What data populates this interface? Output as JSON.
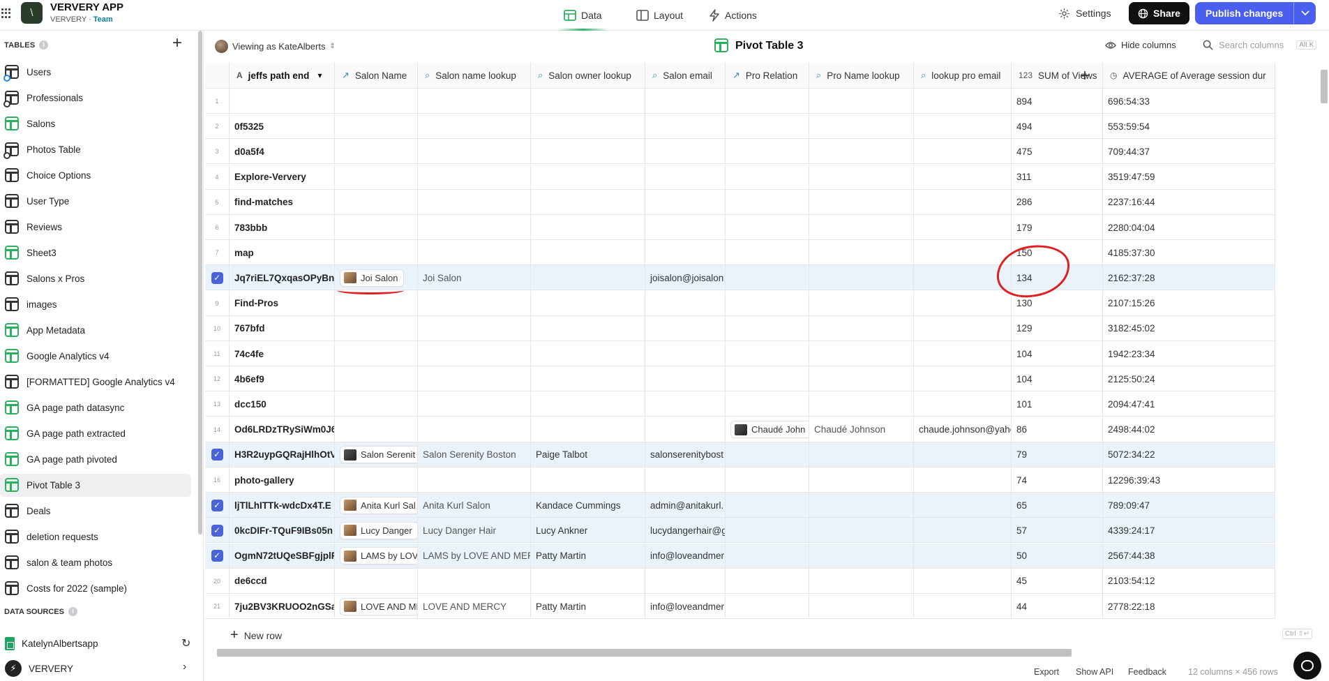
{
  "app": {
    "name": "VERVERY APP",
    "org": "VERVERY",
    "plan": "Team",
    "logo_char": "\\"
  },
  "topnav": {
    "data": "Data",
    "layout": "Layout",
    "actions": "Actions",
    "settings": "Settings",
    "share": "Share",
    "publish": "Publish changes"
  },
  "sidebar": {
    "tables_heading": "TABLES",
    "items": [
      {
        "label": "Users",
        "icon": "table-icon-users",
        "green": false
      },
      {
        "label": "Professionals",
        "icon": "table-icon",
        "green": false
      },
      {
        "label": "Salons",
        "icon": "table-icon",
        "green": true
      },
      {
        "label": "Photos Table",
        "icon": "table-icon",
        "green": false
      },
      {
        "label": "Choice Options",
        "icon": "table-icon",
        "green": false
      },
      {
        "label": "User Type",
        "icon": "table-icon",
        "green": false
      },
      {
        "label": "Reviews",
        "icon": "table-icon",
        "green": false
      },
      {
        "label": "Sheet3",
        "icon": "table-icon",
        "green": true
      },
      {
        "label": "Salons x Pros",
        "icon": "table-icon",
        "green": false
      },
      {
        "label": "images",
        "icon": "table-icon",
        "green": false
      },
      {
        "label": "App Metadata",
        "icon": "table-icon",
        "green": true
      },
      {
        "label": "Google Analytics v4",
        "icon": "table-icon",
        "green": true
      },
      {
        "label": "[FORMATTED] Google Analytics v4",
        "icon": "table-icon",
        "green": false
      },
      {
        "label": "GA page path datasync",
        "icon": "table-icon",
        "green": true
      },
      {
        "label": "GA page path extracted",
        "icon": "table-icon",
        "green": true
      },
      {
        "label": "GA page path pivoted",
        "icon": "table-icon",
        "green": true
      },
      {
        "label": "Pivot Table 3",
        "icon": "table-icon",
        "green": true
      },
      {
        "label": "Deals",
        "icon": "table-icon",
        "green": false
      },
      {
        "label": "deletion requests",
        "icon": "table-icon",
        "green": false
      },
      {
        "label": "salon & team photos",
        "icon": "table-icon",
        "green": false
      },
      {
        "label": "Costs for 2022 (sample)",
        "icon": "table-icon",
        "green": false
      }
    ],
    "data_sources_heading": "DATA SOURCES",
    "data_sources": [
      {
        "label": "KatelynAlbertsapp"
      },
      {
        "label": "VERVERY"
      }
    ]
  },
  "toolbar": {
    "viewing_as": "Viewing as KateAlberts",
    "title": "Pivot Table 3",
    "hide_columns": "Hide columns",
    "search_placeholder": "Search columns",
    "search_shortcut": "Alt K"
  },
  "grid": {
    "columns": [
      {
        "label": "jeffs path end",
        "icon": "A"
      },
      {
        "label": "Salon Name",
        "icon": "relation"
      },
      {
        "label": "Salon name lookup",
        "icon": "lookup"
      },
      {
        "label": "Salon owner lookup",
        "icon": "lookup"
      },
      {
        "label": "Salon email",
        "icon": "lookup"
      },
      {
        "label": "Pro Relation",
        "icon": "relation"
      },
      {
        "label": "Pro Name lookup",
        "icon": "lookup"
      },
      {
        "label": "lookup pro email",
        "icon": "lookup"
      },
      {
        "label": "SUM of Views",
        "icon": "123"
      },
      {
        "label": "AVERAGE of Average session dur",
        "icon": "clock"
      }
    ],
    "rows": [
      {
        "n": "1",
        "sel": false,
        "path": "",
        "salon": "",
        "salon_lookup": "",
        "owner": "",
        "email": "",
        "pro": "",
        "pro_name": "",
        "pro_email": "",
        "views": "894",
        "avg": "696:54:33"
      },
      {
        "n": "2",
        "sel": false,
        "path": "0f5325",
        "salon": "",
        "salon_lookup": "",
        "owner": "",
        "email": "",
        "pro": "",
        "pro_name": "",
        "pro_email": "",
        "views": "494",
        "avg": "553:59:54"
      },
      {
        "n": "3",
        "sel": false,
        "path": "d0a5f4",
        "salon": "",
        "salon_lookup": "",
        "owner": "",
        "email": "",
        "pro": "",
        "pro_name": "",
        "pro_email": "",
        "views": "475",
        "avg": "709:44:37"
      },
      {
        "n": "4",
        "sel": false,
        "path": "Explore-Ververy",
        "salon": "",
        "salon_lookup": "",
        "owner": "",
        "email": "",
        "pro": "",
        "pro_name": "",
        "pro_email": "",
        "views": "311",
        "avg": "3519:47:59"
      },
      {
        "n": "5",
        "sel": false,
        "path": "find-matches",
        "salon": "",
        "salon_lookup": "",
        "owner": "",
        "email": "",
        "pro": "",
        "pro_name": "",
        "pro_email": "",
        "views": "286",
        "avg": "2237:16:44"
      },
      {
        "n": "6",
        "sel": false,
        "path": "783bbb",
        "salon": "",
        "salon_lookup": "",
        "owner": "",
        "email": "",
        "pro": "",
        "pro_name": "",
        "pro_email": "",
        "views": "179",
        "avg": "2280:04:04"
      },
      {
        "n": "7",
        "sel": false,
        "path": "map",
        "salon": "",
        "salon_lookup": "",
        "owner": "",
        "email": "",
        "pro": "",
        "pro_name": "",
        "pro_email": "",
        "views": "150",
        "avg": "4185:37:30"
      },
      {
        "n": "8",
        "sel": true,
        "path": "Jq7riEL7QxqasOPyBnF",
        "salon": "Joi Salon",
        "salon_lookup": "Joi Salon",
        "owner": "",
        "email": "joisalon@joisalon",
        "pro": "",
        "pro_name": "",
        "pro_email": "",
        "views": "134",
        "avg": "2162:37:28"
      },
      {
        "n": "9",
        "sel": false,
        "path": "Find-Pros",
        "salon": "",
        "salon_lookup": "",
        "owner": "",
        "email": "",
        "pro": "",
        "pro_name": "",
        "pro_email": "",
        "views": "130",
        "avg": "2107:15:26"
      },
      {
        "n": "10",
        "sel": false,
        "path": "767bfd",
        "salon": "",
        "salon_lookup": "",
        "owner": "",
        "email": "",
        "pro": "",
        "pro_name": "",
        "pro_email": "",
        "views": "129",
        "avg": "3182:45:02"
      },
      {
        "n": "11",
        "sel": false,
        "path": "74c4fe",
        "salon": "",
        "salon_lookup": "",
        "owner": "",
        "email": "",
        "pro": "",
        "pro_name": "",
        "pro_email": "",
        "views": "104",
        "avg": "1942:23:34"
      },
      {
        "n": "12",
        "sel": false,
        "path": "4b6ef9",
        "salon": "",
        "salon_lookup": "",
        "owner": "",
        "email": "",
        "pro": "",
        "pro_name": "",
        "pro_email": "",
        "views": "104",
        "avg": "2125:50:24"
      },
      {
        "n": "13",
        "sel": false,
        "path": "dcc150",
        "salon": "",
        "salon_lookup": "",
        "owner": "",
        "email": "",
        "pro": "",
        "pro_name": "",
        "pro_email": "",
        "views": "101",
        "avg": "2094:47:41"
      },
      {
        "n": "14",
        "sel": false,
        "path": "Od6LRDzTRySiWm0J6",
        "salon": "",
        "salon_lookup": "",
        "owner": "",
        "email": "",
        "pro": "Chaudé John",
        "pro_name": "Chaudé Johnson",
        "pro_email": "chaude.johnson@yahc",
        "views": "86",
        "avg": "2498:44:02"
      },
      {
        "n": "15",
        "sel": true,
        "path": "H3R2uypGQRajHlhOtV",
        "salon": "Salon Serenit",
        "salon_lookup": "Salon Serenity Boston",
        "owner": "Paige Talbot",
        "email": "salonserenitybost",
        "pro": "",
        "pro_name": "",
        "pro_email": "",
        "views": "79",
        "avg": "5072:34:22"
      },
      {
        "n": "16",
        "sel": false,
        "path": "photo-gallery",
        "salon": "",
        "salon_lookup": "",
        "owner": "",
        "email": "",
        "pro": "",
        "pro_name": "",
        "pro_email": "",
        "views": "74",
        "avg": "12296:39:43"
      },
      {
        "n": "17",
        "sel": true,
        "path": "ljTlLhITTk-wdcDx4T.E",
        "salon": "Anita Kurl Sal",
        "salon_lookup": "Anita Kurl Salon",
        "owner": "Kandace Cummings",
        "email": "admin@anitakurl.",
        "pro": "",
        "pro_name": "",
        "pro_email": "",
        "views": "65",
        "avg": "789:09:47"
      },
      {
        "n": "18",
        "sel": true,
        "path": "0kcDIFr-TQuF9IBs05n",
        "salon": "Lucy Danger",
        "salon_lookup": "Lucy Danger Hair",
        "owner": "Lucy  Ankner",
        "email": "lucydangerhair@g",
        "pro": "",
        "pro_name": "",
        "pro_email": "",
        "views": "57",
        "avg": "4339:24:17"
      },
      {
        "n": "19",
        "sel": true,
        "path": "OgmN72tUQeSBFgjplR",
        "salon": "LAMS by LOV",
        "salon_lookup": "LAMS by LOVE AND MEF",
        "owner": "Patty Martin",
        "email": "info@loveandmer",
        "pro": "",
        "pro_name": "",
        "pro_email": "",
        "views": "50",
        "avg": "2567:44:38"
      },
      {
        "n": "20",
        "sel": false,
        "path": "de6ccd",
        "salon": "",
        "salon_lookup": "",
        "owner": "",
        "email": "",
        "pro": "",
        "pro_name": "",
        "pro_email": "",
        "views": "45",
        "avg": "2103:54:12"
      },
      {
        "n": "21",
        "sel": false,
        "path": "7ju2BV3KRUOO2nGSa",
        "salon": "LOVE AND ME",
        "salon_lookup": "LOVE AND MERCY",
        "owner": "Patty Martin",
        "email": "info@loveandmer",
        "pro": "",
        "pro_name": "",
        "pro_email": "",
        "views": "44",
        "avg": "2778:22:18"
      }
    ],
    "new_row": "New row",
    "shortcut_hint": "Ctrl ⇧↵"
  },
  "footer": {
    "export": "Export",
    "show_api": "Show API",
    "feedback": "Feedback",
    "summary": "12 columns × 456 rows"
  },
  "colors": {
    "accent": "#4a5ff0",
    "selected_row": "#eaf3fa",
    "checkbox": "#4a63d8",
    "table_green": "#2bb15d",
    "annotation_red": "#e02020"
  }
}
